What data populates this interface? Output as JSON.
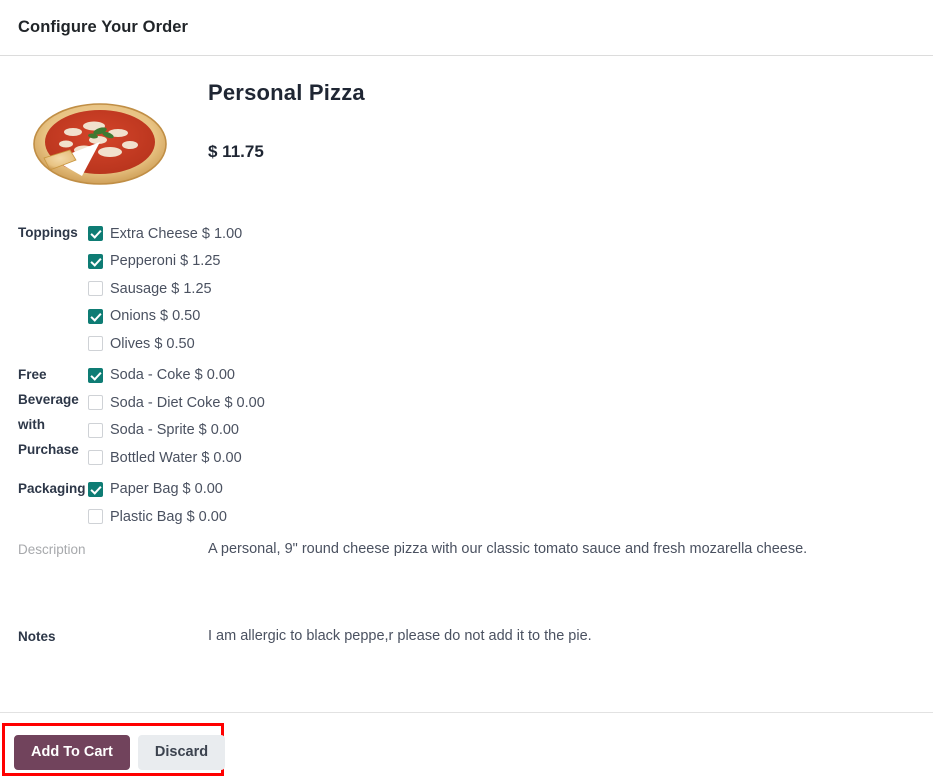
{
  "header": {
    "title": "Configure Your Order"
  },
  "product": {
    "name": "Personal Pizza",
    "price": "$ 11.75",
    "image_alt": "pizza-photo"
  },
  "groups": [
    {
      "label": "Toppings",
      "options": [
        {
          "label": "Extra Cheese $ 1.00",
          "checked": true
        },
        {
          "label": "Pepperoni $ 1.25",
          "checked": true
        },
        {
          "label": "Sausage $ 1.25",
          "checked": false
        },
        {
          "label": "Onions $ 0.50",
          "checked": true
        },
        {
          "label": "Olives $ 0.50",
          "checked": false
        }
      ]
    },
    {
      "label": "Free Beverage with Purchase",
      "options": [
        {
          "label": "Soda - Coke $ 0.00",
          "checked": true
        },
        {
          "label": "Soda - Diet Coke $ 0.00",
          "checked": false
        },
        {
          "label": "Soda - Sprite $ 0.00",
          "checked": false
        },
        {
          "label": "Bottled Water $ 0.00",
          "checked": false
        }
      ]
    },
    {
      "label": "Packaging",
      "options": [
        {
          "label": "Paper Bag $ 0.00",
          "checked": true
        },
        {
          "label": "Plastic Bag $ 0.00",
          "checked": false
        }
      ]
    }
  ],
  "description": {
    "label": "Description",
    "value": "A personal, 9\" round cheese pizza with our classic tomato sauce and fresh mozarella cheese."
  },
  "notes": {
    "label": "Notes",
    "value": "I am allergic to black peppe,r please do not add it to the pie."
  },
  "footer": {
    "add_to_cart_label": "Add To Cart",
    "discard_label": "Discard"
  },
  "colors": {
    "checkbox_checked": "#0e7c74",
    "primary_button": "#71435c",
    "secondary_button": "#e9ecef",
    "highlight_box": "#ff0000"
  }
}
